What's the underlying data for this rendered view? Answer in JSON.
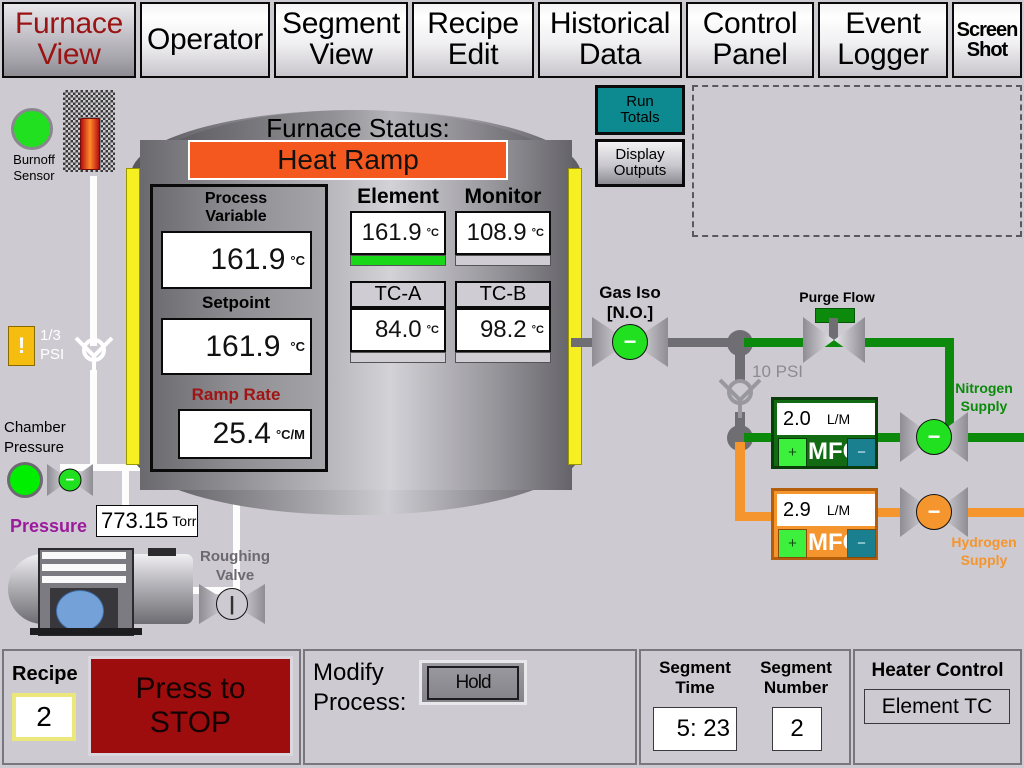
{
  "app": {
    "title": "Furnace View"
  },
  "tabs": [
    {
      "id": "furnace-view",
      "line1": "Furnace",
      "line2": "View",
      "active": true
    },
    {
      "id": "operator",
      "line1": "Operator",
      "line2": "",
      "active": false
    },
    {
      "id": "segment-view",
      "line1": "Segment",
      "line2": "View",
      "active": false
    },
    {
      "id": "recipe-edit",
      "line1": "Recipe",
      "line2": "Edit",
      "active": false
    },
    {
      "id": "historical-data",
      "line1": "Historical",
      "line2": "Data",
      "active": false
    },
    {
      "id": "control-panel",
      "line1": "Control",
      "line2": "Panel",
      "active": false
    },
    {
      "id": "event-logger",
      "line1": "Event",
      "line2": "Logger",
      "active": false
    },
    {
      "id": "screen-shot",
      "line1": "Screen",
      "line2": "Shot",
      "active": false
    }
  ],
  "furnace": {
    "status_title": "Furnace Status:",
    "status_value": "Heat Ramp",
    "status_color": "#f4581f",
    "process_variable": {
      "label1": "Process",
      "label2": "Variable",
      "value": "161.9",
      "unit": "°C"
    },
    "setpoint": {
      "label": "Setpoint",
      "value": "161.9",
      "unit": "°C"
    },
    "ramp_rate": {
      "label": "Ramp Rate",
      "value": "25.4",
      "unit": "°C/M",
      "label_color": "#a01414"
    }
  },
  "temps": {
    "element": {
      "label": "Element",
      "value": "161.9",
      "unit": "°C",
      "bar_pct": 100,
      "bar_color": "#19d819"
    },
    "monitor": {
      "label": "Monitor",
      "value": "108.9",
      "unit": "°C",
      "bar_pct": 0,
      "bar_color": "#19d819"
    },
    "tc_a": {
      "label": "TC-A",
      "value": "84.0",
      "unit": "°C",
      "bar_pct": 0,
      "bar_color": "#19d819"
    },
    "tc_b": {
      "label": "TC-B",
      "value": "98.2",
      "unit": "°C",
      "bar_pct": 0,
      "bar_color": "#19d819"
    }
  },
  "left": {
    "burnoff": {
      "label1": "Burnoff",
      "label2": "Sensor",
      "state_color": "#20e020"
    },
    "psi_badge": {
      "icon": "warning-icon",
      "glyph": "!",
      "bg": "#f5bd10",
      "label1": "1/3",
      "label2": "PSI"
    },
    "chamber": {
      "label1": "Chamber",
      "label2": "Pressure",
      "state_color": "#00ee00"
    },
    "pressure": {
      "label": "Pressure",
      "label_color": "#9c1a9c",
      "value": "773.15",
      "unit": "Torr"
    },
    "roughing_valve": {
      "label1": "Roughing",
      "label2": "Valve",
      "state": "|",
      "hub_color": "#cdcbd1",
      "hub_text_color": "#333"
    },
    "pump": {
      "name": "vacuum-pump"
    }
  },
  "gas": {
    "iso_valve": {
      "label1": "Gas Iso",
      "label2": "[N.O.]",
      "state": "−",
      "hub_color": "#20e020"
    },
    "psi_tap": {
      "label": "10 PSI"
    },
    "purge_flow": {
      "label": "Purge Flow",
      "actuator_color": "#0b8a0b"
    },
    "nitrogen": {
      "supply_label1": "Nitrogen",
      "supply_label2": "Supply",
      "color": "#0b8a0b",
      "mfc": {
        "label": "MFC",
        "value": "2.0",
        "unit": "L/M",
        "plus": "+",
        "minus": "−",
        "body_color": "#126b12",
        "plus_color": "#3ef03e",
        "minus_color": "#1a7f8f"
      },
      "valve": {
        "state": "−",
        "hub_color": "#20e020"
      }
    },
    "hydrogen": {
      "supply_label1": "Hydrogen",
      "supply_label2": "Supply",
      "color": "#f4952e",
      "mfc": {
        "label": "MFC",
        "value": "2.9",
        "unit": "L/M",
        "plus": "+",
        "minus": "−",
        "body_color": "#f4952e",
        "plus_color": "#3ef03e",
        "minus_color": "#1a7f8f"
      },
      "valve": {
        "state": "−",
        "hub_color": "#f4952e"
      }
    }
  },
  "topright": {
    "run_totals": {
      "line1": "Run",
      "line2": "Totals",
      "bg": "#0d8a8f"
    },
    "display_outputs": {
      "line1": "Display",
      "line2": "Outputs"
    }
  },
  "statusbar": {
    "recipe": {
      "label": "Recipe",
      "value": "2"
    },
    "stop_button": {
      "line1": "Press to",
      "line2": "STOP",
      "bg": "#9e0d0d"
    },
    "modify_process": {
      "label1": "Modify",
      "label2": "Process:",
      "button": "Hold"
    },
    "segment_time": {
      "label1": "Segment",
      "label2": "Time",
      "value": "5: 23"
    },
    "segment_number": {
      "label1": "Segment",
      "label2": "Number",
      "value": "2"
    },
    "heater_control": {
      "label": "Heater Control",
      "value": "Element TC"
    }
  }
}
